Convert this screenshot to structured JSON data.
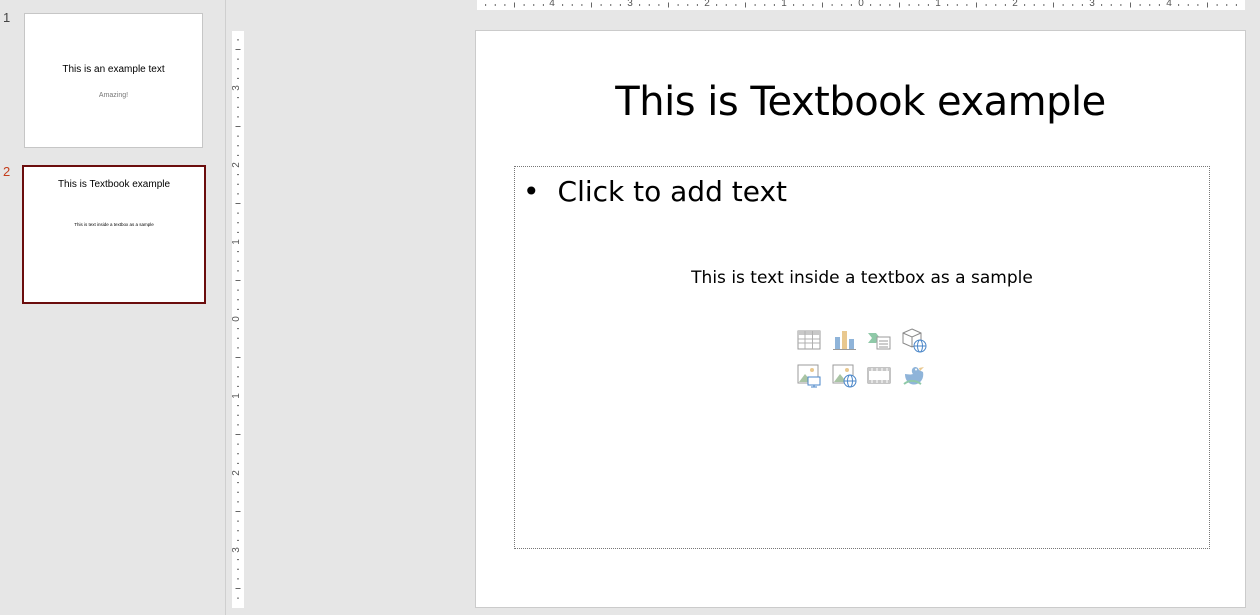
{
  "thumbnails": [
    {
      "number": "1",
      "title": "This is an example text",
      "subtitle": "Amazing!"
    },
    {
      "number": "2",
      "title": "This is Textbook example",
      "body": "This is text inside a textbox as a sample"
    }
  ],
  "rulers": {
    "horizontal_labels": [
      "4",
      "3",
      "2",
      "1",
      "0",
      "1",
      "2",
      "3",
      "4"
    ],
    "vertical_labels": [
      "3",
      "2",
      "1",
      "0",
      "1",
      "2",
      "3"
    ]
  },
  "slide": {
    "title": "This is Textbook example",
    "placeholder_bullet": "•",
    "placeholder_text": "Click to add text",
    "textbox": "This is text inside a textbox as a sample"
  },
  "insert_icons": [
    "insert-table-icon",
    "insert-chart-icon",
    "insert-smartart-icon",
    "insert-3d-model-icon",
    "insert-picture-icon",
    "insert-online-picture-icon",
    "insert-video-icon",
    "insert-icons-icon"
  ],
  "colors": {
    "active_thumbnail_border": "#6b0d0d",
    "active_slide_number": "#c43e1c",
    "workspace_background": "#e6e6e6"
  }
}
